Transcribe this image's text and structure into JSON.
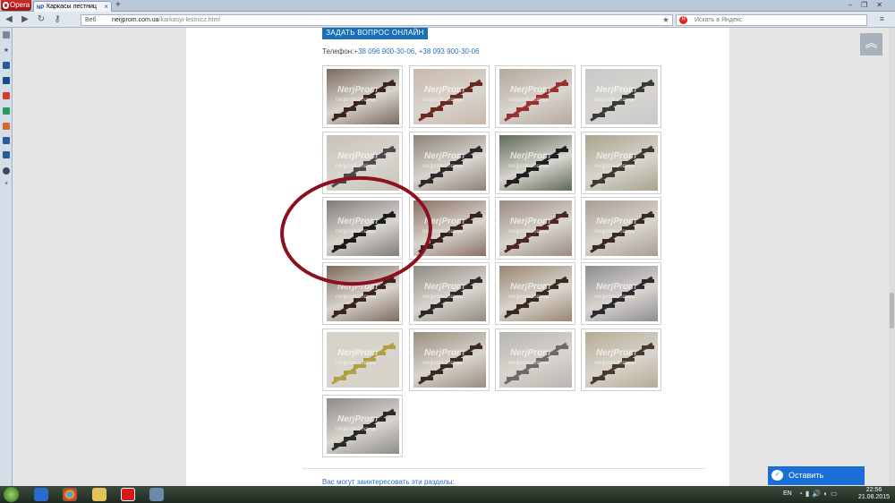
{
  "browser": {
    "opera_label": "Opera",
    "tab_title": "Каркасы лестниц",
    "tab_favicon": "NP",
    "new_tab": "+",
    "url_prefix": "Веб",
    "url_domain": "nerjprom.com.ua",
    "url_path": "/karkasyi-lestnicz.html",
    "search_placeholder": "Искать в Яндекс"
  },
  "page": {
    "ask_button": "ЗАДАТЬ ВОПРОС ОНЛАЙН",
    "phone_label": "Телефон:",
    "phone_1": "+38 096 900-30-06",
    "phone_sep": ", ",
    "phone_2": "+38 093 900-30-06",
    "more_text": "Вас могут заинтересовать эти разделы:",
    "watermark": "NerjProm",
    "watermark_small": "nerjprom.com.ua"
  },
  "gallery": {
    "rows": 6,
    "items": [
      {
        "bg": "#7a6a5e",
        "beam": "#3b2420"
      },
      {
        "bg": "#c9b8aa",
        "beam": "#6a2a22"
      },
      {
        "bg": "#b4a89c",
        "beam": "#9a3030"
      },
      {
        "bg": "#c6c9cc",
        "beam": "#3a3a3a"
      },
      {
        "bg": "#c8c2b8",
        "beam": "#4a4a4a"
      },
      {
        "bg": "#8c8378",
        "beam": "#2a2a2a"
      },
      {
        "bg": "#5e6a56",
        "beam": "#1e1e1e"
      },
      {
        "bg": "#a8a48c",
        "beam": "#3a3a30"
      },
      {
        "bg": "#7f7c78",
        "beam": "#1b1b1b"
      },
      {
        "bg": "#8a6f62",
        "beam": "#3a2220"
      },
      {
        "bg": "#9a8a82",
        "beam": "#4a2626"
      },
      {
        "bg": "#a89e94",
        "beam": "#3a2a26"
      },
      {
        "bg": "#7e6a5c",
        "beam": "#3a241c"
      },
      {
        "bg": "#8f8a82",
        "beam": "#2a2a2a"
      },
      {
        "bg": "#9a8670",
        "beam": "#3a2a1e"
      },
      {
        "bg": "#8d8d92",
        "beam": "#2a2a30"
      },
      {
        "bg": "#d8d2c4",
        "beam": "#b0a040"
      },
      {
        "bg": "#9a8d7c",
        "beam": "#3a2a22"
      },
      {
        "bg": "#b7b5b0",
        "beam": "#6a6a6a"
      },
      {
        "bg": "#b6ab92",
        "beam": "#4a3a2a"
      },
      {
        "bg": "#8e8c88",
        "beam": "#2a2a2a"
      }
    ]
  },
  "chat": {
    "label": "Оставить сообщение"
  },
  "taskbar": {
    "lang": "EN",
    "time": "22:56",
    "date": "21.08.2015"
  },
  "colors": {
    "accent": "#1a6fb8",
    "chat": "#1a6fd6",
    "ellipse": "#8b1020",
    "link": "#2a6ebb"
  }
}
